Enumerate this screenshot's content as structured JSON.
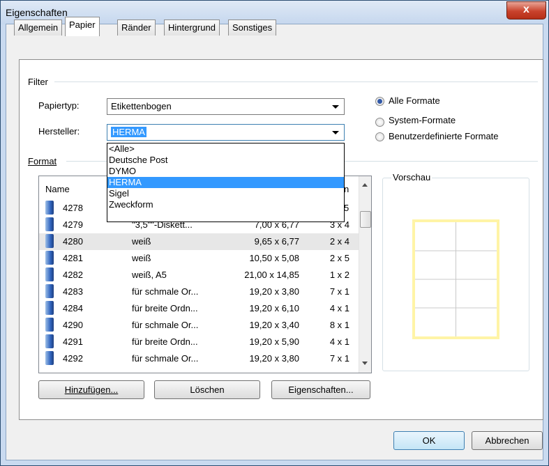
{
  "window": {
    "title": "Eigenschaften",
    "close_glyph": "x"
  },
  "tabs": [
    {
      "label": "Allgemein",
      "active": false
    },
    {
      "label": "Papier",
      "active": true
    },
    {
      "label": "Ränder",
      "active": false
    },
    {
      "label": "Hintergrund",
      "active": false
    },
    {
      "label": "Sonstiges",
      "active": false
    }
  ],
  "filter": {
    "group_label": "Filter",
    "papiertyp_label": "Papiertyp:",
    "papiertyp_value": "Etikettenbogen",
    "hersteller_label": "Hersteller:",
    "hersteller_value": "HERMA",
    "hersteller_options": [
      "<Alle>",
      "Deutsche Post",
      "DYMO",
      "HERMA",
      "Sigel",
      "Zweckform"
    ],
    "hersteller_selected_index": 3,
    "radios": [
      {
        "label": "Alle Formate",
        "checked": true
      },
      {
        "label": "System-Formate",
        "checked": false
      },
      {
        "label": "Benutzerdefinierte Formate",
        "checked": false
      }
    ]
  },
  "format": {
    "group_label": "Format",
    "columns": {
      "name": "Name",
      "partial_header": "n"
    },
    "partial_row": {
      "name": "4278",
      "layout": "5"
    },
    "rows": [
      {
        "name": "4279",
        "desc": "\"3,5\"\"-Diskett...",
        "size": "7,00 x 6,77",
        "layout": "3 x 4"
      },
      {
        "name": "4280",
        "desc": "weiß",
        "size": "9,65 x 6,77",
        "layout": "2 x 4"
      },
      {
        "name": "4281",
        "desc": "weiß",
        "size": "10,50 x 5,08",
        "layout": "2 x 5"
      },
      {
        "name": "4282",
        "desc": "weiß, A5",
        "size": "21,00 x 14,85",
        "layout": "1 x 2"
      },
      {
        "name": "4283",
        "desc": "für schmale Or...",
        "size": "19,20 x 3,80",
        "layout": "7 x 1"
      },
      {
        "name": "4284",
        "desc": "für breite Ordn...",
        "size": "19,20 x 6,10",
        "layout": "4 x 1"
      },
      {
        "name": "4290",
        "desc": "für schmale Or...",
        "size": "19,20 x 3,40",
        "layout": "8 x 1"
      },
      {
        "name": "4291",
        "desc": "für breite Ordn...",
        "size": "19,20 x 5,90",
        "layout": "4 x 1"
      },
      {
        "name": "4292",
        "desc": "für schmale Or...",
        "size": "19,20 x 3,80",
        "layout": "7 x 1"
      }
    ],
    "highlighted_row_index": 1
  },
  "preview": {
    "label": "Vorschau",
    "grid_cols": 2,
    "grid_rows": 4,
    "border_color": "#fff4a6"
  },
  "buttons": {
    "add": "Hinzufügen...",
    "delete": "Löschen",
    "properties": "Eigenschaften...",
    "ok": "OK",
    "cancel": "Abbrechen"
  },
  "colors": {
    "selection": "#3399ff",
    "radio_dot": "#3158a8"
  }
}
